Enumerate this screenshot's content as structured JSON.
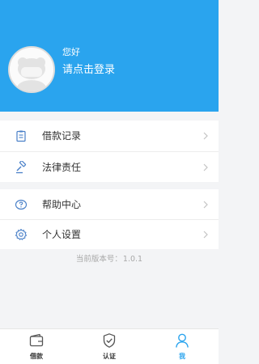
{
  "profile": {
    "greeting": "您好",
    "login_prompt": "请点击登录"
  },
  "menu": {
    "loan_records": "借款记录",
    "legal_liability": "法律责任",
    "help_center": "帮助中心",
    "personal_settings": "个人设置"
  },
  "version": {
    "label": "当前版本号：",
    "number": "1.0.1"
  },
  "tabs": {
    "loan": "借款",
    "verify": "认证",
    "me": "我"
  },
  "colors": {
    "accent": "#2aa4ee",
    "icon": "#4a80c8"
  }
}
